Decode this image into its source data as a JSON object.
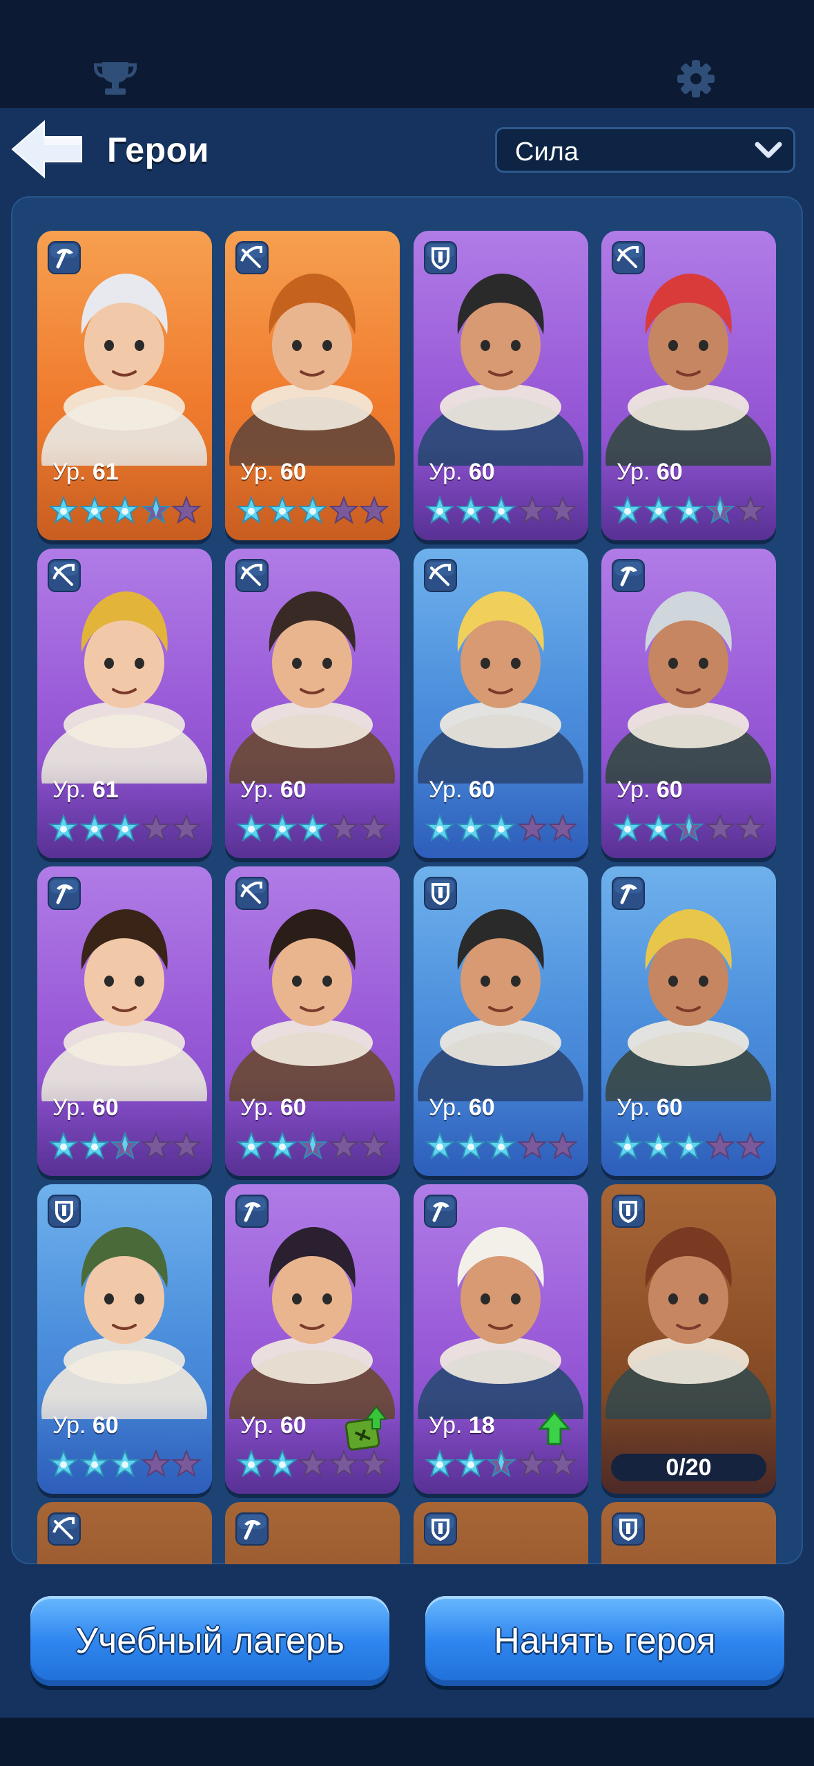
{
  "header": {
    "title": "Герои",
    "sort": {
      "value": "Сила"
    }
  },
  "icons": {
    "trophy": "trophy-icon",
    "settings": "gear-icon",
    "back": "back-arrow-icon",
    "class_pickaxe": "pickaxe-class-icon",
    "class_crossbow": "crossbow-class-icon",
    "class_shield": "shield-class-icon"
  },
  "level_prefix": "Ур.",
  "heroes": [
    {
      "cls": "pickaxe",
      "bg": "orange",
      "level": "61",
      "stars": 3.5
    },
    {
      "cls": "crossbow",
      "bg": "orange",
      "level": "60",
      "stars": 3
    },
    {
      "cls": "shield",
      "bg": "purple",
      "level": "60",
      "stars": 3
    },
    {
      "cls": "crossbow",
      "bg": "purple",
      "level": "60",
      "stars": 3.5
    },
    {
      "cls": "crossbow",
      "bg": "purple",
      "level": "61",
      "stars": 3
    },
    {
      "cls": "crossbow",
      "bg": "purple",
      "level": "60",
      "stars": 3
    },
    {
      "cls": "crossbow",
      "bg": "blue",
      "level": "60",
      "stars": 3
    },
    {
      "cls": "pickaxe",
      "bg": "purple",
      "level": "60",
      "stars": 2.5
    },
    {
      "cls": "pickaxe",
      "bg": "purple",
      "level": "60",
      "stars": 2.5
    },
    {
      "cls": "crossbow",
      "bg": "purple",
      "level": "60",
      "stars": 2.5
    },
    {
      "cls": "shield",
      "bg": "blue",
      "level": "60",
      "stars": 3
    },
    {
      "cls": "pickaxe",
      "bg": "blue",
      "level": "60",
      "stars": 3
    },
    {
      "cls": "shield",
      "bg": "blue",
      "level": "60",
      "stars": 3
    },
    {
      "cls": "pickaxe",
      "bg": "purple",
      "level": "60",
      "stars": 2,
      "upgrade": "book"
    },
    {
      "cls": "pickaxe",
      "bg": "purple",
      "level": "18",
      "stars": 2.5,
      "upgrade": "arrow"
    },
    {
      "cls": "shield",
      "bg": "brown",
      "shards": "0/20"
    }
  ],
  "partial_row": [
    {
      "cls": "crossbow",
      "bg": "brown"
    },
    {
      "cls": "pickaxe",
      "bg": "brown"
    },
    {
      "cls": "shield",
      "bg": "brown"
    },
    {
      "cls": "shield",
      "bg": "brown"
    }
  ],
  "buttons": {
    "training_camp": "Учебный лагерь",
    "hire_hero": "Нанять героя"
  },
  "colors": {
    "star_filled": "#5fd4f0",
    "star_empty": "#7a5a9a",
    "accent": "#2f86ee"
  }
}
